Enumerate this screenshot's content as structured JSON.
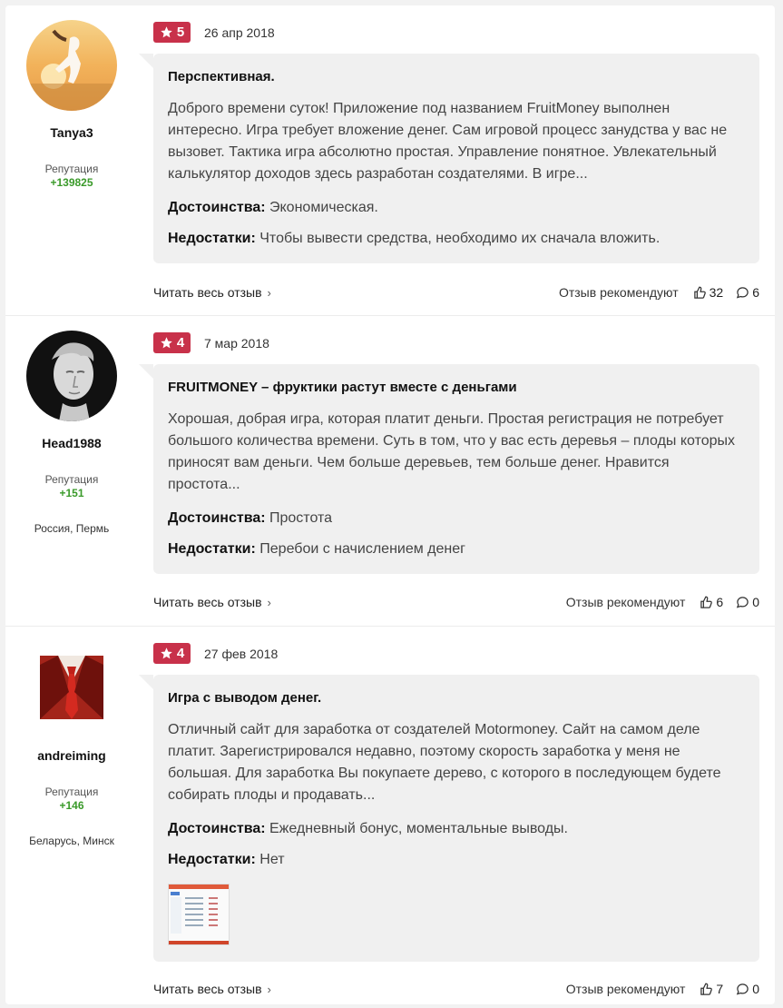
{
  "reviews": [
    {
      "author": {
        "name": "Tanya3",
        "rep_label": "Репутация",
        "rep_value": "+139825",
        "location": ""
      },
      "rating": "5",
      "date": "26 апр 2018",
      "title": "Перспективная.",
      "text": "Доброго времени суток! Приложение под названием FruitMoney выполнен интересно. Игра требует вложение денег. Сам игровой процесс занудства у вас не вызовет. Тактика игра абсолютно простая. Управление понятное. Увлекательный калькулятор доходов здесь разработан создателями. В игре...",
      "pros_label": "Достоинства:",
      "pros": "Экономическая.",
      "cons_label": "Недостатки:",
      "cons": "Чтобы вывести средства, необходимо их сначала вложить.",
      "read_more": "Читать весь отзыв",
      "recommend": "Отзыв рекомендуют",
      "likes": "32",
      "comments": "6"
    },
    {
      "author": {
        "name": "Head1988",
        "rep_label": "Репутация",
        "rep_value": "+151",
        "location": "Россия, Пермь"
      },
      "rating": "4",
      "date": "7 мар 2018",
      "title": "FRUITMONEY – фруктики растут вместе с деньгами",
      "text": "Хорошая, добрая игра, которая платит деньги. Простая регистрация не потребует большого количества времени. Суть в том, что у вас есть деревья – плоды которых приносят вам деньги. Чем больше деревьев, тем больше денег. Нравится простота...",
      "pros_label": "Достоинства:",
      "pros": "Простота",
      "cons_label": "Недостатки:",
      "cons": "Перебои с начислением денег",
      "read_more": "Читать весь отзыв",
      "recommend": "Отзыв рекомендуют",
      "likes": "6",
      "comments": "0"
    },
    {
      "author": {
        "name": "andreiming",
        "rep_label": "Репутация",
        "rep_value": "+146",
        "location": "Беларусь, Минск"
      },
      "rating": "4",
      "date": "27 фев 2018",
      "title": "Игра с выводом денег.",
      "text": "Отличный сайт для заработка от создателей Motormoney. Сайт на самом деле платит. Зарегистрировался недавно, поэтому скорость заработка у меня не большая. Для заработка Вы покупаете дерево, с которого в последующем будете собирать плоды и продавать...",
      "pros_label": "Достоинства:",
      "pros": "Ежедневный бонус, моментальные выводы.",
      "cons_label": "Недостатки:",
      "cons": "Нет",
      "read_more": "Читать весь отзыв",
      "recommend": "Отзыв рекомендуют",
      "likes": "7",
      "comments": "0"
    }
  ],
  "colors": {
    "badge": "#c8314a",
    "reputation": "#3a9a2a",
    "bubble": "#f0f0f0"
  },
  "icons": {
    "rating": "star-icon",
    "likes": "thumbs-up-icon",
    "comments": "speech-bubble-icon",
    "more": "chevron-right-icon"
  }
}
